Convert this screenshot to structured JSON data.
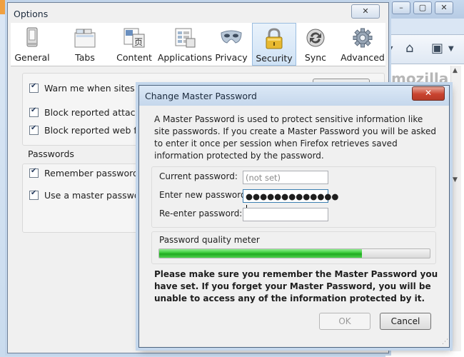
{
  "browser": {
    "watermark": "mozilla",
    "window_buttons": [
      "–",
      "▢",
      "✕"
    ]
  },
  "options": {
    "title": "Options",
    "close_glyph": "✕",
    "tabs": [
      {
        "label": "General",
        "icon": "general-icon"
      },
      {
        "label": "Tabs",
        "icon": "tabs-icon"
      },
      {
        "label": "Content",
        "icon": "content-icon"
      },
      {
        "label": "Applications",
        "icon": "applications-icon"
      },
      {
        "label": "Privacy",
        "icon": "privacy-mask-icon"
      },
      {
        "label": "Security",
        "icon": "padlock-icon",
        "selected": true
      },
      {
        "label": "Sync",
        "icon": "sync-icon"
      },
      {
        "label": "Advanced",
        "icon": "gear-icon"
      }
    ],
    "security": {
      "checkboxes_top": [
        {
          "label": "Warn me when sites try to install add-ons",
          "visible_label": "Warn me when sites try to install add-ons",
          "checked": true
        },
        {
          "label": "Block reported attack sites",
          "checked": true
        },
        {
          "label": "Block reported web forgeries",
          "checked": true
        }
      ],
      "passwords_heading": "Passwords",
      "checkboxes_passwords": [
        {
          "label": "Remember passwords for sites",
          "checked": true
        },
        {
          "label": "Use a master password",
          "checked": true
        }
      ]
    }
  },
  "dialog": {
    "title": "Change Master Password",
    "close_glyph": "✕",
    "intro": "A Master Password is used to protect sensitive information like site passwords. If you create a Master Password you will be asked to enter it once per session when Firefox retrieves saved information protected by the password.",
    "fields": {
      "current_label": "Current password:",
      "current_value": "(not set)",
      "new_label": "Enter new password:",
      "new_value": "●●●●●●●●●●●●●",
      "reenter_label": "Re-enter password:",
      "reenter_value": ""
    },
    "meter_label": "Password quality meter",
    "meter_fraction": 0.75,
    "warning": "Please make sure you remember the Master Password you have set. If you forget your Master Password, you will be unable to access any of the information protected by it.",
    "ok_label": "OK",
    "cancel_label": "Cancel",
    "colors": {
      "meter": "#2fbf2f",
      "close": "#c9432f"
    }
  }
}
